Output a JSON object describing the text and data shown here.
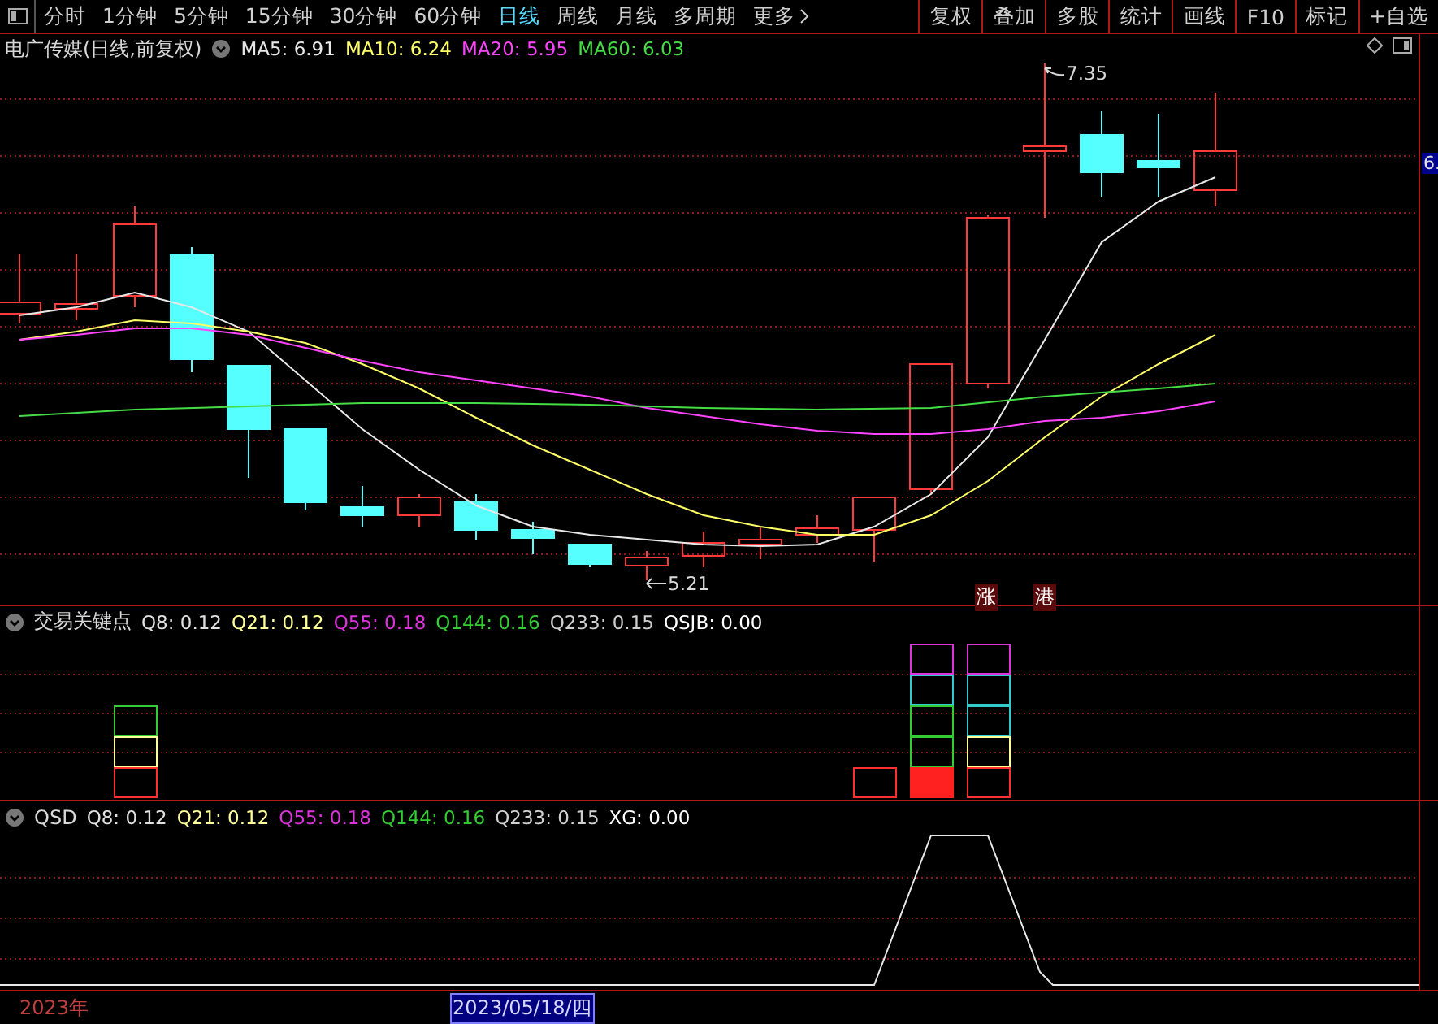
{
  "toolbar": {
    "periods": [
      {
        "label": "分时",
        "selected": false
      },
      {
        "label": "1分钟",
        "selected": false
      },
      {
        "label": "5分钟",
        "selected": false
      },
      {
        "label": "15分钟",
        "selected": false
      },
      {
        "label": "30分钟",
        "selected": false
      },
      {
        "label": "60分钟",
        "selected": false
      },
      {
        "label": "日线",
        "selected": true
      },
      {
        "label": "周线",
        "selected": false
      },
      {
        "label": "月线",
        "selected": false
      },
      {
        "label": "多周期",
        "selected": false
      },
      {
        "label": "更多",
        "selected": false
      }
    ],
    "tools": [
      "复权",
      "叠加",
      "多股",
      "统计",
      "画线",
      "F10",
      "标记",
      "+自选"
    ]
  },
  "main_chart": {
    "title": "电广传媒(日线,前复权)",
    "indicators": [
      {
        "label": "MA5: 6.91",
        "color": "#e8e8e8"
      },
      {
        "label": "MA10: 6.24",
        "color": "#ffff66"
      },
      {
        "label": "MA20: 5.95",
        "color": "#ff44ff"
      },
      {
        "label": "MA60: 6.03",
        "color": "#44dd44"
      }
    ],
    "high_label": "7.35",
    "low_label": "5.21",
    "markers": [
      "涨",
      "港"
    ],
    "price_axis_label": "6."
  },
  "panels": [
    {
      "title": "交易关键点",
      "values": [
        {
          "label": "Q8: 0.12",
          "color": "#e0e0e0"
        },
        {
          "label": "Q21: 0.12",
          "color": "#ffff99"
        },
        {
          "label": "Q55: 0.18",
          "color": "#dd33dd"
        },
        {
          "label": "Q144: 0.16",
          "color": "#33cc33"
        },
        {
          "label": "Q233: 0.15",
          "color": "#d0d0d0"
        },
        {
          "label": "QSJB: 0.00",
          "color": "#ffffff"
        }
      ]
    },
    {
      "title": "QSD",
      "values": [
        {
          "label": "Q8: 0.12",
          "color": "#e0e0e0"
        },
        {
          "label": "Q21: 0.12",
          "color": "#ffff99"
        },
        {
          "label": "Q55: 0.18",
          "color": "#dd33dd"
        },
        {
          "label": "Q144: 0.16",
          "color": "#33cc33"
        },
        {
          "label": "Q233: 0.15",
          "color": "#d0d0d0"
        },
        {
          "label": "XG: 0.00",
          "color": "#ffffff"
        }
      ]
    }
  ],
  "time_axis": {
    "year_label": "2023年",
    "cursor_date": "2023/05/18/四"
  }
}
